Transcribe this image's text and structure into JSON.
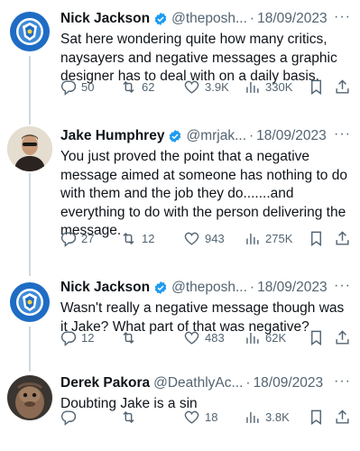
{
  "tweets": [
    {
      "name": "Nick Jackson",
      "verified": true,
      "handle": "@theposh...",
      "separator": "·",
      "date": "18/09/2023",
      "text": "Sat here wondering quite how many critics, naysayers and negative messages a graphic designer has to deal with on a daily basis.",
      "replies": "50",
      "retweets": "62",
      "likes": "3.9K",
      "views": "330K"
    },
    {
      "name": "Jake Humphrey",
      "verified": true,
      "handle": "@mrjak...",
      "separator": "·",
      "date": "18/09/2023",
      "text": "You just proved the point that a negative message aimed at someone has nothing to do with them and the job they do.......and everything to do with the person delivering the message.",
      "replies": "27",
      "retweets": "12",
      "likes": "943",
      "views": "275K"
    },
    {
      "name": "Nick Jackson",
      "verified": true,
      "handle": "@theposh...",
      "separator": "·",
      "date": "18/09/2023",
      "text": "Wasn't really a negative message though was it Jake? What part of that was negative?",
      "replies": "12",
      "retweets": "",
      "likes": "483",
      "views": "62K"
    },
    {
      "name": "Derek Pakora",
      "verified": false,
      "handle": "@DeathlyAc...",
      "separator": "·",
      "date": "18/09/2023",
      "text": "Doubting Jake is a sin",
      "replies": "",
      "retweets": "",
      "likes": "18",
      "views": "3.8K"
    }
  ],
  "more_label": "···",
  "icons": {
    "reply": "reply-icon",
    "retweet": "retweet-icon",
    "like": "heart-icon",
    "views": "views-icon",
    "bookmark": "bookmark-icon",
    "share": "share-icon",
    "verified": "verified-badge-icon"
  },
  "colors": {
    "text": "#0f1419",
    "secondary": "#536471",
    "verified": "#1d9bf0",
    "thread_line": "#cfd9de",
    "club_blue": "#1f6cc4"
  }
}
